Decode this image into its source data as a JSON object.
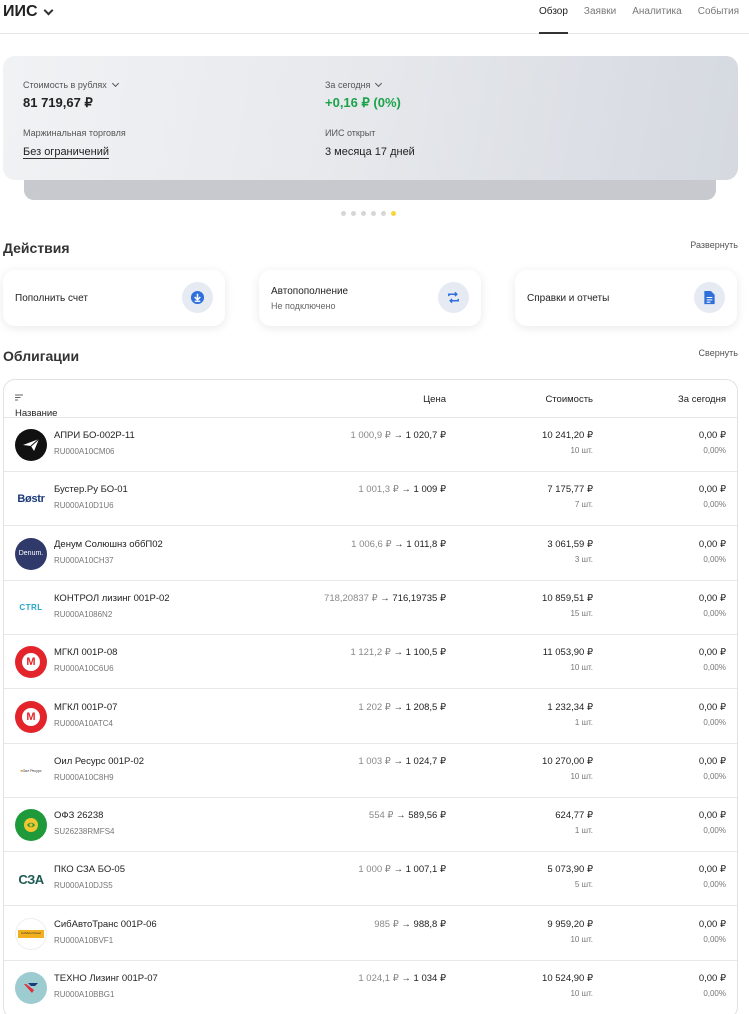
{
  "header": {
    "account": "ИИС",
    "tabs": [
      "Обзор",
      "Заявки",
      "Аналитика",
      "События"
    ]
  },
  "summary": {
    "value_label": "Стоимость в рублях",
    "value": "81 719,67 ₽",
    "today_label": "За сегодня",
    "today_value": "+0,16 ₽ (0%)",
    "margin_label": "Маржинальная торговля",
    "margin_value": "Без ограничений",
    "opened_label": "ИИС открыт",
    "opened_value": "3 месяца 17 дней",
    "pager_total": 6,
    "pager_active": 6
  },
  "actions": {
    "title": "Действия",
    "expand": "Развернуть",
    "items": [
      {
        "title": "Пополнить счет",
        "icon": "download-icon"
      },
      {
        "title": "Автопополнение",
        "subtitle": "Не подключено",
        "icon": "refresh-icon"
      },
      {
        "title": "Справки и отчеты",
        "icon": "document-icon"
      }
    ]
  },
  "bonds": {
    "title": "Облигации",
    "collapse": "Свернуть",
    "columns": [
      "Название",
      "Цена",
      "Стоимость",
      "За сегодня"
    ],
    "rows": [
      {
        "name": "АПРИ БО-002Р-11",
        "isin": "RU000A10CM06",
        "price_old": "1 000,9 ₽",
        "price_new": "1 020,7 ₽",
        "cost": "10 241,20 ₽",
        "qty": "10 шт.",
        "today": "0,00 ₽",
        "today_pct": "0,00%",
        "logo": "apri-logo",
        "logo_text": ""
      },
      {
        "name": "Бустер.Ру БО-01",
        "isin": "RU000A10D1U6",
        "price_old": "1 001,3 ₽",
        "price_new": "1 009 ₽",
        "cost": "7 175,77 ₽",
        "qty": "7 шт.",
        "today": "0,00 ₽",
        "today_pct": "0,00%",
        "logo": "buster-logo",
        "logo_text": "Bøstr"
      },
      {
        "name": "Денум Солюшнз оббП02",
        "isin": "RU000A10CH37",
        "price_old": "1 006,6 ₽",
        "price_new": "1 011,8 ₽",
        "cost": "3 061,59 ₽",
        "qty": "3 шт.",
        "today": "0,00 ₽",
        "today_pct": "0,00%",
        "logo": "denum-logo",
        "logo_text": "Denum."
      },
      {
        "name": "КОНТРОЛ лизинг 001Р-02",
        "isin": "RU000A1086N2",
        "price_old": "718,20837 ₽",
        "price_new": "716,19735 ₽",
        "cost": "10 859,51 ₽",
        "qty": "15 шт.",
        "today": "0,00 ₽",
        "today_pct": "0,00%",
        "logo": "ctrl-logo",
        "logo_text": "CTRL"
      },
      {
        "name": "МГКЛ 001Р-08",
        "isin": "RU000A10C6U6",
        "price_old": "1 121,2 ₽",
        "price_new": "1 100,5 ₽",
        "cost": "11 053,90 ₽",
        "qty": "10 шт.",
        "today": "0,00 ₽",
        "today_pct": "0,00%",
        "logo": "mgkl-logo",
        "logo_text": "M"
      },
      {
        "name": "МГКЛ 001Р-07",
        "isin": "RU000A10ATC4",
        "price_old": "1 202 ₽",
        "price_new": "1 208,5 ₽",
        "cost": "1 232,34 ₽",
        "qty": "1 шт.",
        "today": "0,00 ₽",
        "today_pct": "0,00%",
        "logo": "mgkl-logo",
        "logo_text": "M"
      },
      {
        "name": "Оил Ресурс 001Р-02",
        "isin": "RU000A10C8H9",
        "price_old": "1 003 ₽",
        "price_new": "1 024,7 ₽",
        "cost": "10 270,00 ₽",
        "qty": "10 шт.",
        "today": "0,00 ₽",
        "today_pct": "0,00%",
        "logo": "oil-resurs-logo",
        "logo_text": "Оил Ресурс"
      },
      {
        "name": "ОФЗ 26238",
        "isin": "SU26238RMFS4",
        "price_old": "554 ₽",
        "price_new": "589,56 ₽",
        "cost": "624,77 ₽",
        "qty": "1 шт.",
        "today": "0,00 ₽",
        "today_pct": "0,00%",
        "logo": "minfin-emblem-logo",
        "logo_text": ""
      },
      {
        "name": "ПКО СЗА БО-05",
        "isin": "RU000A10DJS5",
        "price_old": "1 000 ₽",
        "price_new": "1 007,1 ₽",
        "cost": "5 073,90 ₽",
        "qty": "5 шт.",
        "today": "0,00 ₽",
        "today_pct": "0,00%",
        "logo": "sza-logo",
        "logo_text": "СЗА"
      },
      {
        "name": "СибАвтоТранс 001Р-06",
        "isin": "RU000A10BVF1",
        "price_old": "985 ₽",
        "price_new": "988,8 ₽",
        "cost": "9 959,20 ₽",
        "qty": "10 шт.",
        "today": "0,00 ₽",
        "today_pct": "0,00%",
        "logo": "sibavtotrans-logo",
        "logo_text": "СибАвтоТранс"
      },
      {
        "name": "ТЕХНО Лизинг 001Р-07",
        "isin": "RU000A10BBG1",
        "price_old": "1 024,1 ₽",
        "price_new": "1 034 ₽",
        "cost": "10 524,90 ₽",
        "qty": "10 шт.",
        "today": "0,00 ₽",
        "today_pct": "0,00%",
        "logo": "techno-leasing-logo",
        "logo_text": ""
      }
    ]
  }
}
